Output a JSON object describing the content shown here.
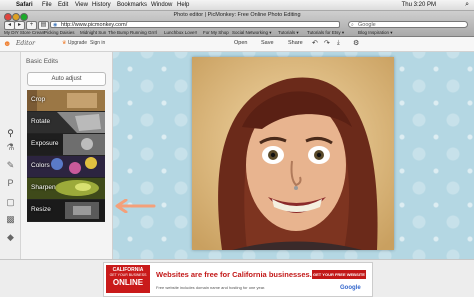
{
  "menubar": {
    "app_name": "Safari",
    "items": [
      "File",
      "Edit",
      "View",
      "History",
      "Bookmarks",
      "Window",
      "Help"
    ],
    "clock": "Thu 3:20 PM"
  },
  "browser": {
    "window_title": "Photo editor | PicMonkey: Free Online Photo Editing",
    "url": "http://www.picmonkey.com/",
    "search_placeholder": "Google",
    "bookmarks": [
      "My DIY Store Cream",
      "Picking Daisies",
      "Midnight Sun",
      "The Bump",
      "Running Grrrl",
      "Lunchbox Love!!",
      "For My Shop",
      "Social Networking ▾",
      "Tutorials ▾",
      "Tutorials for Etsy ▾",
      "Blog Inspiration ▾"
    ]
  },
  "app": {
    "logo_text": "Editor",
    "upgrade_label": "Upgrade",
    "signin_label": "Sign in",
    "toolbar": {
      "open": "Open",
      "save": "Save",
      "share": "Share"
    },
    "panel_title": "Basic Edits",
    "auto_adjust": "Auto adjust",
    "tools": [
      {
        "label": "Crop",
        "color": "#8a6a3a"
      },
      {
        "label": "Rotate",
        "color": "#5a5a5a"
      },
      {
        "label": "Exposure",
        "color": "#3e3e3e"
      },
      {
        "label": "Colors",
        "color": "#5c4a7a"
      },
      {
        "label": "Sharpen",
        "color": "#6a7a2e"
      },
      {
        "label": "Resize",
        "color": "#2f2f2f"
      }
    ],
    "rail_icons": [
      "settings-icon",
      "wand-icon",
      "brush-icon",
      "text-icon",
      "frame-icon",
      "textures-icon",
      "diamond-icon"
    ],
    "accent_color": "#f08336",
    "canvas_bg": "#b4d7e3"
  },
  "ad": {
    "logo_line1": "CALIFORNIA",
    "logo_line2": "GET YOUR BUSINESS",
    "logo_line3": "ONLINE",
    "headline": "Websites are free for California businesses.",
    "sub": "Free website includes domain name and hosting for one year.",
    "cta": "GET YOUR FREE WEBSITE ▸",
    "google": "Google"
  }
}
